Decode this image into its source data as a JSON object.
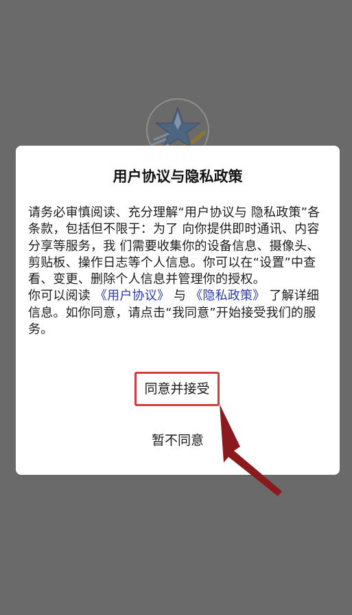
{
  "dialog": {
    "title": "用户协议与隐私政策",
    "paragraph1": " 请务必审慎阅读、充分理解“用户协议与 隐私政策”各条款，包括但不限于：为了 向你提供即时通讯、内容分享等服务，我 们需要收集你的设备信息、摄像头、剪贴板、操作日志等个人信息。你可以在“设置”中查看、变更、删除个人信息并管理你的授权。",
    "p2_prefix": "你可以阅读",
    "user_agreement_link": "《用户协议》",
    "p2_and": "与",
    "privacy_policy_link": "《隐私政策》",
    "p2_suffix": "了解详细信息。如你同意，请点击“我同意”开始接受我们的服务。",
    "agree_label": "同意并接受",
    "disagree_label": "暂不同意"
  },
  "colors": {
    "overlay": "#6a6a6a",
    "link": "#2b3aa8",
    "highlight": "#d63a3a",
    "arrow": "#8b1a1f"
  },
  "icons": {
    "app_logo": "star-logo-icon",
    "annotation": "annotation-arrow"
  }
}
